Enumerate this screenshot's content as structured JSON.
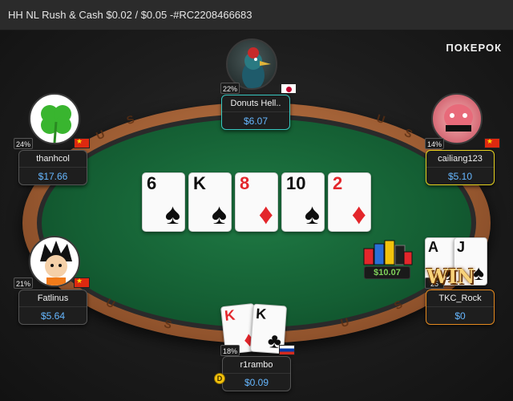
{
  "window": {
    "title": "HH NL Rush & Cash $0.02 / $0.05 -#RC2208466683"
  },
  "brand": {
    "logo_text": "ПОКЕРОК"
  },
  "table": {
    "rail_text": [
      "U",
      "S",
      "U",
      "S",
      "U",
      "S",
      "U",
      "S"
    ]
  },
  "board": {
    "cards": [
      {
        "rank": "6",
        "suit": "♠",
        "color": "black"
      },
      {
        "rank": "K",
        "suit": "♠",
        "color": "black"
      },
      {
        "rank": "8",
        "suit": "♦",
        "color": "red"
      },
      {
        "rank": "10",
        "suit": "♠",
        "color": "black"
      },
      {
        "rank": "2",
        "suit": "♦",
        "color": "red"
      }
    ]
  },
  "pot": {
    "amount": "$10.07"
  },
  "players": {
    "top": {
      "name": "Donuts Hell..",
      "stack": "$6.07",
      "pct": "22%",
      "flag": "jp"
    },
    "top_left": {
      "name": "thanhcol",
      "stack": "$17.66",
      "pct": "24%",
      "flag": "cn"
    },
    "top_right": {
      "name": "cailiang123",
      "stack": "$5.10",
      "pct": "14%",
      "flag": "cn"
    },
    "bottom_left": {
      "name": "Fatlinus",
      "stack": "$5.64",
      "pct": "21%",
      "flag": "cn"
    },
    "bottom_right": {
      "name": "TKC_Rock",
      "stack": "$0",
      "pct": "25",
      "win_text": "WIN",
      "cards": [
        {
          "rank": "A",
          "suit": "♠"
        },
        {
          "rank": "J",
          "suit": "♠"
        }
      ]
    },
    "hero": {
      "name": "r1rambo",
      "stack": "$0.09",
      "pct": "18%",
      "flag": "ru",
      "cards": [
        {
          "rank": "K",
          "suit": "♦",
          "color": "red"
        },
        {
          "rank": "K",
          "suit": "♣",
          "color": "black"
        }
      ],
      "dealer_button": "D"
    }
  },
  "colors": {
    "felt": "#145e33",
    "stack_blue": "#66b7ff",
    "pot_green": "#7fd15a",
    "win_gold": "#f7d27a"
  }
}
